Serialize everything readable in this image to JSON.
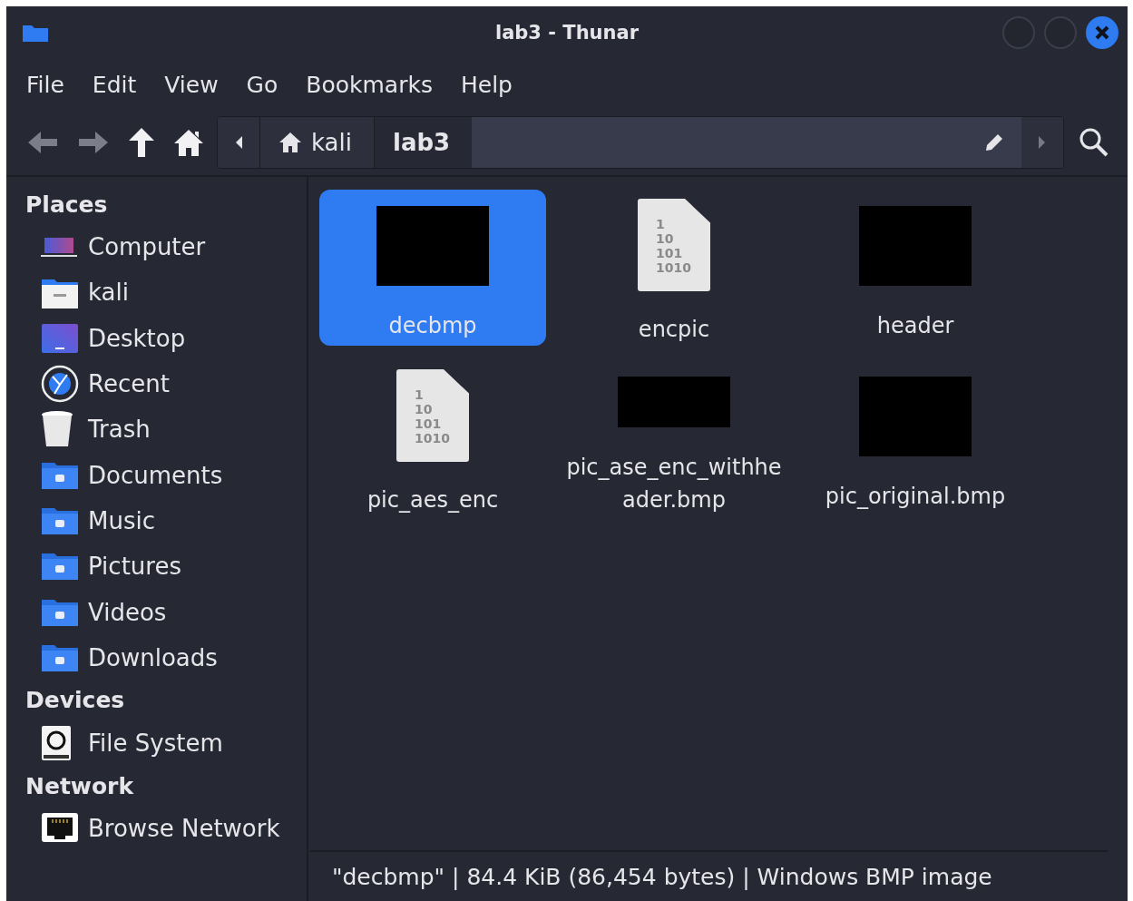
{
  "window": {
    "title": "lab3 - Thunar"
  },
  "menu": [
    "File",
    "Edit",
    "View",
    "Go",
    "Bookmarks",
    "Help"
  ],
  "toolbar": {
    "nav": [
      {
        "kind": "back",
        "disabled": true
      },
      {
        "kind": "forward",
        "disabled": true
      },
      {
        "kind": "up",
        "disabled": false
      },
      {
        "kind": "home",
        "disabled": false
      }
    ]
  },
  "path_bar": {
    "crumbs": [
      {
        "label": "kali",
        "kind": "home",
        "selected": false
      },
      {
        "label": "lab3",
        "kind": "folder",
        "selected": true
      }
    ]
  },
  "sidebar": {
    "sections": [
      {
        "title": "Places",
        "items": [
          "Computer",
          "kali",
          "Desktop",
          "Recent",
          "Trash",
          "Documents",
          "Music",
          "Pictures",
          "Videos",
          "Downloads"
        ]
      },
      {
        "title": "Devices",
        "items": [
          "File System"
        ]
      },
      {
        "title": "Network",
        "items": [
          "Browse Network"
        ]
      }
    ]
  },
  "files": [
    {
      "name": "decbmp",
      "kind": "image",
      "selected": true
    },
    {
      "name": "encpic",
      "kind": "binary",
      "icon_text": [
        "1",
        "10",
        "101",
        "1010"
      ],
      "selected": false
    },
    {
      "name": "header",
      "kind": "image",
      "selected": false
    },
    {
      "name": "pic_aes_enc",
      "kind": "binary",
      "icon_text": [
        "1",
        "10",
        "101",
        "1010"
      ],
      "selected": false
    },
    {
      "name": "pic_ase_enc_withheader.bmp",
      "kind": "image",
      "selected": false
    },
    {
      "name": "pic_original.bmp",
      "kind": "image",
      "selected": false
    }
  ],
  "status_bar": "\"decbmp\" | 84.4 KiB (86,454 bytes) | Windows BMP image"
}
